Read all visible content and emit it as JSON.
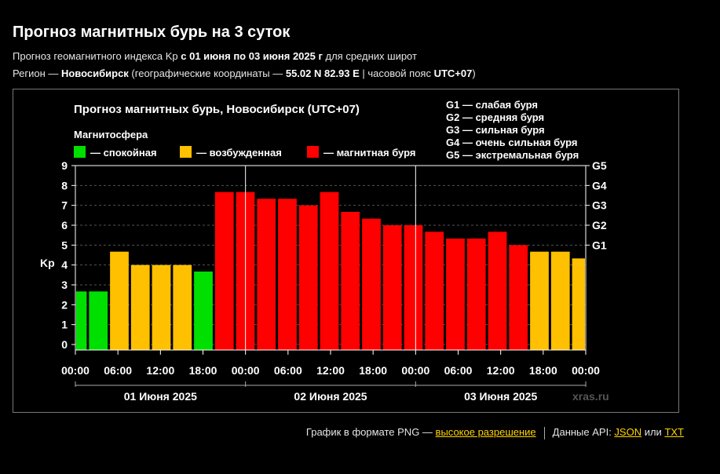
{
  "page": {
    "title": "Прогноз магнитных бурь на 3 суток",
    "subtitle": {
      "part1": "Прогноз геомагнитного индекса Kp ",
      "part2": "с 01 июня по 03 июня 2025 г",
      "part3": " для средних широт"
    },
    "region": {
      "part1": "Регион — ",
      "city": "Новосибирск",
      "part2": " (географические координаты — ",
      "coords": "55.02 N 82.93 E",
      "part3": " | часовой пояс ",
      "tz": "UTC+07",
      "part4": ")"
    }
  },
  "chart_data": {
    "type": "bar",
    "title": "Прогноз магнитных бурь, Новосибирск (UTC+07)",
    "legend_title": "Магнитосфера",
    "legend": [
      {
        "label": "— спокойная",
        "color": "#00e000"
      },
      {
        "label": "— возбужденная",
        "color": "#ffc000"
      },
      {
        "label": "— магнитная буря",
        "color": "#ff0000"
      }
    ],
    "g_legend": [
      "G1 — слабая буря",
      "G2 — средняя буря",
      "G3 — сильная буря",
      "G4 — очень сильная буря",
      "G5 — экстремальная буря"
    ],
    "ylabel": "Kp",
    "ylim": [
      0,
      9
    ],
    "y_ticks": [
      "0",
      "1",
      "2",
      "3",
      "4",
      "5",
      "6",
      "7",
      "8",
      "9"
    ],
    "g_ticks": [
      {
        "label": "G1",
        "value": 5
      },
      {
        "label": "G2",
        "value": 6
      },
      {
        "label": "G3",
        "value": 7
      },
      {
        "label": "G4",
        "value": 8
      },
      {
        "label": "G5",
        "value": 9
      }
    ],
    "x_ticks": [
      "00:00",
      "06:00",
      "12:00",
      "18:00",
      "00:00",
      "06:00",
      "12:00",
      "18:00",
      "00:00",
      "06:00",
      "12:00",
      "18:00",
      "00:00"
    ],
    "days": [
      "01 Июня 2025",
      "02 Июня 2025",
      "03 Июня 2025"
    ],
    "values": [
      2.67,
      2.67,
      4.67,
      4.0,
      4.0,
      4.0,
      3.67,
      7.67,
      7.67,
      7.33,
      7.33,
      7.0,
      7.67,
      6.67,
      6.33,
      6.0,
      6.0,
      5.67,
      5.33,
      5.33,
      5.67,
      5.0,
      4.67,
      4.67,
      4.33
    ],
    "colors": {
      "quiet": "#00e000",
      "active": "#ffc000",
      "storm": "#ff0000"
    },
    "grid": true,
    "watermark": "xras.ru"
  },
  "footer": {
    "png_text": "График в формате PNG — ",
    "png_link": "высокое разрешение",
    "api_text": "Данные API: ",
    "json_link": "JSON",
    "or_text": " или ",
    "txt_link": "TXT"
  }
}
